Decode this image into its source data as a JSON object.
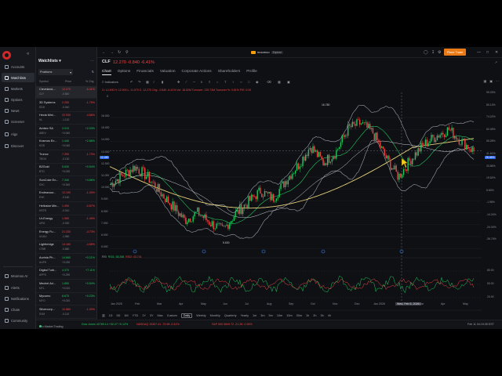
{
  "sidebar": {
    "items": [
      {
        "label": "Accounts",
        "icon": "wallet-icon"
      },
      {
        "label": "Watchlists",
        "icon": "list-icon",
        "active": true
      },
      {
        "label": "Markets",
        "icon": "chart-icon"
      },
      {
        "label": "Options",
        "icon": "options-icon"
      },
      {
        "label": "News",
        "icon": "news-icon"
      },
      {
        "label": "Screener",
        "icon": "filter-icon"
      },
      {
        "label": "Algo",
        "icon": "algo-icon"
      },
      {
        "label": "Discover",
        "icon": "compass-icon"
      }
    ],
    "bottom_items": [
      {
        "label": "Moomoo AI",
        "icon": "ai-icon"
      },
      {
        "label": "Alerts",
        "icon": "bell-icon"
      },
      {
        "label": "Notifications",
        "icon": "mail-icon"
      },
      {
        "label": "Chats",
        "icon": "chat-icon"
      },
      {
        "label": "Community",
        "icon": "people-icon"
      }
    ]
  },
  "watchlist": {
    "title": "Watchlists",
    "selector": "Positions",
    "columns": [
      "Symbol",
      "Price",
      "% Chg"
    ],
    "rows": [
      {
        "name": "Cleveland-...",
        "ticker": "CLF",
        "price": "12.270",
        "change": "-0.840",
        "pct": "-6.41%",
        "dir": "dn"
      },
      {
        "name": "3D Systems",
        "ticker": "DDD",
        "price": "2.250",
        "change": "-0.040",
        "pct": "-1.75%",
        "dir": "dn"
      },
      {
        "name": "Hecla Mini...",
        "ticker": "HL",
        "price": "22.930",
        "change": "-1.120",
        "pct": "-4.66%",
        "dir": "dn"
      },
      {
        "name": "Ambev SA",
        "ticker": "ABEV",
        "price": "3.010",
        "change": "+0.060",
        "pct": "+2.03%",
        "dir": "up"
      },
      {
        "name": "Kosmos En...",
        "ticker": "KOS",
        "price": "1.440",
        "change": "+0.040",
        "pct": "+2.86%",
        "dir": "up"
      },
      {
        "name": "Tronox",
        "ticker": "TROX",
        "price": "7.390",
        "change": "-0.130",
        "pct": "-1.73%",
        "dir": "dn"
      },
      {
        "name": "B2Gold",
        "ticker": "BTG",
        "price": "5.630",
        "change": "+0.030",
        "pct": "+0.54%",
        "dir": "up"
      },
      {
        "name": "SunCoke En...",
        "ticker": "SXC",
        "price": "7.340",
        "change": "+0.340",
        "pct": "+4.86%",
        "dir": "up"
      },
      {
        "name": "Endeavour...",
        "ticker": "EXK",
        "price": "12.190",
        "change": "-0.160",
        "pct": "-1.30%",
        "dir": "dn"
      },
      {
        "name": "Heliostar Min...",
        "ticker": "HSTR",
        "price": "1.490",
        "change": "-0.010",
        "pct": "-0.67%",
        "dir": "dn"
      },
      {
        "name": "Ur-Energy",
        "ticker": "URG",
        "price": "1.980",
        "change": "-0.030",
        "pct": "-1.49%",
        "dir": "dn"
      },
      {
        "name": "Energy Fu...",
        "ticker": "UUUU",
        "price": "21.330",
        "change": "-1.060",
        "pct": "-4.73%",
        "dir": "dn"
      },
      {
        "name": "Lightbridge",
        "ticker": "LTBR",
        "price": "14.180",
        "change": "-0.680",
        "pct": "-4.58%",
        "dir": "dn"
      },
      {
        "name": "Aurinia Ph...",
        "ticker": "AUPH",
        "price": "14.660",
        "change": "+0.030",
        "pct": "+0.21%",
        "dir": "up"
      },
      {
        "name": "Digital Turb...",
        "ticker": "APPS",
        "price": "4.370",
        "change": "+0.290",
        "pct": "+7.11%",
        "dir": "up"
      },
      {
        "name": "Mechel Ad...",
        "ticker": "MTL",
        "price": "1.850",
        "change": "+0.010",
        "pct": "+0.54%",
        "dir": "up"
      },
      {
        "name": "Mycomo",
        "ticker": "MYO",
        "price": "8.670",
        "change": "+0.020",
        "pct": "+0.23%",
        "dir": "up"
      },
      {
        "name": "Silvercorp...",
        "ticker": "SVM",
        "price": "10.880",
        "change": "-0.110",
        "pct": "-1.00%",
        "dir": "dn"
      }
    ]
  },
  "topbar": {
    "brand": "moomoo",
    "explore": "Explore",
    "trade_button": "Place Trade"
  },
  "header": {
    "symbol": "CLF",
    "price_line": "12.270  -0.840  -6.41%",
    "tabs": [
      "Chart",
      "Options",
      "Financials",
      "Valuation",
      "Corporate Actions",
      "Shareholders",
      "Profile"
    ],
    "active_tab": "Chart",
    "indicators_label": "Indicators"
  },
  "ohlc": {
    "line": "O: 12.490   H: 12.900   L: 11.970   C: 12.270   Chg: -0.840   -6.41%   Vol: 18.62M   Turnover: 229.73M   Turnover %: 3.61%   P/E: 0.00",
    "sub": "2"
  },
  "chart_data": {
    "type": "candlestick",
    "y_axis": [
      "16.000",
      "15.000",
      "14.000",
      "13.000",
      "12.000",
      "11.000",
      "10.000",
      "9.000",
      "8.000",
      "7.000",
      "6.000",
      "5.000"
    ],
    "y_pct": [
      "95.03%",
      "80.13%",
      "74.22%",
      "62.45%",
      "55.28%",
      "41.61%",
      "33.86%",
      "19.62%",
      "5.83%",
      "-1.98%",
      "-14.24%",
      "-24.04%",
      "-36.74%"
    ],
    "x_axis": [
      "Jan 2025",
      "Feb",
      "Mar",
      "Apr",
      "May",
      "Jun",
      "Jul",
      "Aug",
      "Sep",
      "Oct",
      "Nov",
      "Dec",
      "Jan 2026",
      "Wed, Feb 5, 2026",
      "Mar",
      "Apr",
      "May"
    ],
    "high_label": "16.780",
    "low_label": "5.630",
    "current_price": "12.450",
    "current_pct": "26.46%",
    "approx_closes": [
      9.8,
      10.5,
      11.2,
      10.4,
      9.2,
      8.1,
      7.0,
      7.6,
      6.8,
      6.2,
      7.5,
      8.4,
      9.3,
      8.7,
      10.1,
      11.3,
      12.8,
      11.5,
      12.3,
      14.2,
      14.6,
      13.8,
      11.9,
      10.4,
      11.8,
      12.9,
      13.6,
      14.1,
      13.2,
      12.4
    ],
    "rsi": {
      "label": "RSI",
      "values_label": "RSI1: 38.268",
      "values_label2": "RSI2: 43.741",
      "ticks": [
        "80.00",
        "50.00",
        "20.00"
      ]
    }
  },
  "timeframes": [
    "1D",
    "5D",
    "1M",
    "YTD",
    "1Y",
    "3Y",
    "Max",
    "Custom",
    "Daily",
    "Weekly",
    "Monthly",
    "Quarterly",
    "Yearly",
    "1m",
    "3m",
    "5m",
    "10m",
    "15m",
    "30m",
    "1h",
    "2h",
    "3h",
    "4h"
  ],
  "active_timeframe": "Daily",
  "statusbar": {
    "live": "Pro Market Trading",
    "djia": "Dow Jones  42789.14  +52.27  +0.12%",
    "nasdaq": "NASDAQ  19357.41  -79.98  -0.41%",
    "sp": "S&P 500  5849.72  -21.28  -0.36%",
    "time": "Feb 11 04:19:35 EST"
  }
}
